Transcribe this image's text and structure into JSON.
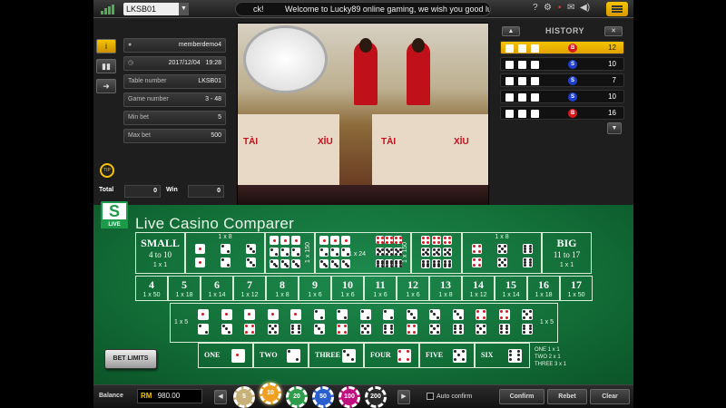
{
  "topbar": {
    "table_select": "LKSB01",
    "marquee_prefix": "ck!",
    "marquee_text": "Welcome to Lucky89 online gaming, we wish you good luck"
  },
  "info": {
    "username": "memberdemo4",
    "date": "2017/12/04",
    "time": "19:28",
    "rows": [
      {
        "label": "Table number",
        "value": "LKSB01"
      },
      {
        "label": "Game number",
        "value": "3 - 48"
      },
      {
        "label": "Min bet",
        "value": "5"
      },
      {
        "label": "Max bet",
        "value": "500"
      }
    ],
    "total_label": "Total",
    "total_value": "0",
    "win_label": "Win",
    "win_value": "0"
  },
  "video": {
    "tai": "TÀI",
    "xiu": "XỈU"
  },
  "history": {
    "title": "HISTORY",
    "rows": [
      {
        "dice": [
          5,
          5,
          2
        ],
        "result": "B",
        "total": "12",
        "selected": true
      },
      {
        "dice": [
          2,
          2,
          6
        ],
        "result": "S",
        "total": "10",
        "selected": false
      },
      {
        "dice": [
          2,
          1,
          4
        ],
        "result": "S",
        "total": "7",
        "selected": false
      },
      {
        "dice": [
          1,
          3,
          6
        ],
        "result": "S",
        "total": "10",
        "selected": false
      },
      {
        "dice": [
          4,
          6,
          6
        ],
        "result": "B",
        "total": "16",
        "selected": false
      }
    ]
  },
  "brand": {
    "logo_letter": "S",
    "logo_live": "LIVE",
    "title": "Live Casino Comparer"
  },
  "board": {
    "small": {
      "title": "SMALL",
      "range": "4 to 10",
      "odds": "1 x 1"
    },
    "big": {
      "title": "BIG",
      "range": "11 to 17",
      "odds": "1 x 1"
    },
    "triples_odds_left": "1 x 8",
    "triples_odds_right": "1 x 8",
    "any_triple_odds": "1 x 150",
    "any_triple_mid": "1 x 24",
    "specific_odds_left": "1 x 150",
    "totals": [
      {
        "n": "4",
        "odds": "1 x 50"
      },
      {
        "n": "5",
        "odds": "1 x 18"
      },
      {
        "n": "6",
        "odds": "1 x 14"
      },
      {
        "n": "7",
        "odds": "1 x 12"
      },
      {
        "n": "8",
        "odds": "1 x 8"
      },
      {
        "n": "9",
        "odds": "1 x 6"
      },
      {
        "n": "10",
        "odds": "1 x 6"
      },
      {
        "n": "11",
        "odds": "1 x 6"
      },
      {
        "n": "12",
        "odds": "1 x 6"
      },
      {
        "n": "13",
        "odds": "1 x 8"
      },
      {
        "n": "14",
        "odds": "1 x 12"
      },
      {
        "n": "15",
        "odds": "1 x 14"
      },
      {
        "n": "16",
        "odds": "1 x 18"
      },
      {
        "n": "17",
        "odds": "1 x 50"
      }
    ],
    "pairs_odds": "1 x 5",
    "singles": [
      "ONE",
      "TWO",
      "THREE",
      "FOUR",
      "FIVE",
      "SIX"
    ],
    "single_notes": [
      "ONE 1 x 1",
      "TWO 2 x 1",
      "THREE 3 x 1"
    ],
    "bet_limits": "BET LIMITS"
  },
  "bottom": {
    "balance_label": "Balance",
    "currency": "RM",
    "balance": "980.00",
    "chips": [
      {
        "value": "5",
        "color": "#c9b27a"
      },
      {
        "value": "10",
        "color": "#f0a020"
      },
      {
        "value": "20",
        "color": "#2e9c4a"
      },
      {
        "value": "50",
        "color": "#2a5fd0"
      },
      {
        "value": "100",
        "color": "#c01080"
      },
      {
        "value": "200",
        "color": "#2a2a2a"
      }
    ],
    "selected_chip": "10",
    "auto_confirm": "Auto confirm",
    "confirm": "Confirm",
    "rebet": "Rebet",
    "clear": "Clear"
  },
  "colors": {
    "accent": "#f5c400",
    "felt": "#137038",
    "big_badge": "#d71920",
    "small_badge": "#1e3fcf"
  },
  "icons": [
    "signal-icon",
    "dropdown-icon",
    "menu-icon",
    "info-icon",
    "chart-icon",
    "arrow-icon",
    "user-icon",
    "clock-icon",
    "flag-uk-icon",
    "sound-icon"
  ]
}
